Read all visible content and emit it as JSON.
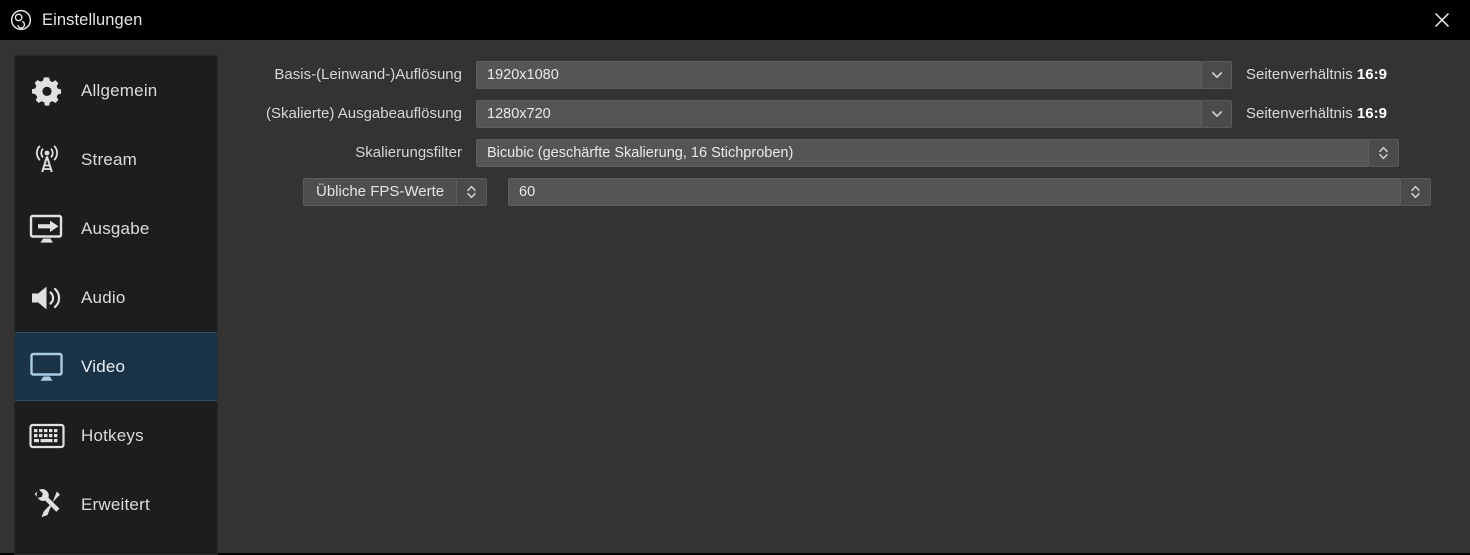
{
  "window": {
    "title": "Einstellungen",
    "logo_icon": "obs-logo-icon",
    "close_icon": "close-icon",
    "accent_selected": "#1b3347",
    "background": "#333333",
    "sidebar_background": "#1d1d1d",
    "field_background": "#555555"
  },
  "sidebar": {
    "items": [
      {
        "label": "Allgemein",
        "icon": "gear-icon",
        "selected": false
      },
      {
        "label": "Stream",
        "icon": "broadcast-icon",
        "selected": false
      },
      {
        "label": "Ausgabe",
        "icon": "monitor-arrow-icon",
        "selected": false
      },
      {
        "label": "Audio",
        "icon": "speaker-icon",
        "selected": false
      },
      {
        "label": "Video",
        "icon": "monitor-icon",
        "selected": true
      },
      {
        "label": "Hotkeys",
        "icon": "keyboard-icon",
        "selected": false
      },
      {
        "label": "Erweitert",
        "icon": "tools-icon",
        "selected": false
      }
    ]
  },
  "video_settings": {
    "base_resolution": {
      "label": "Basis-(Leinwand-)Auflösung",
      "value": "1920x1080",
      "dropdown_icon": "chevron-down-icon",
      "aspect_label": "Seitenverhältnis",
      "aspect_value": "16:9"
    },
    "output_resolution": {
      "label": "(Skalierte) Ausgabeauflösung",
      "value": "1280x720",
      "dropdown_icon": "chevron-down-icon",
      "aspect_label": "Seitenverhältnis",
      "aspect_value": "16:9"
    },
    "downscale_filter": {
      "label": "Skalierungsfilter",
      "value": "Bicubic (geschärfte Skalierung, 16 Stichproben)",
      "spinner_icon": "up-down-chevron-icon"
    },
    "fps": {
      "type_label": "Übliche FPS-Werte",
      "type_spinner_icon": "up-down-chevron-icon",
      "value": "60",
      "value_spinner_icon": "up-down-chevron-icon"
    }
  }
}
